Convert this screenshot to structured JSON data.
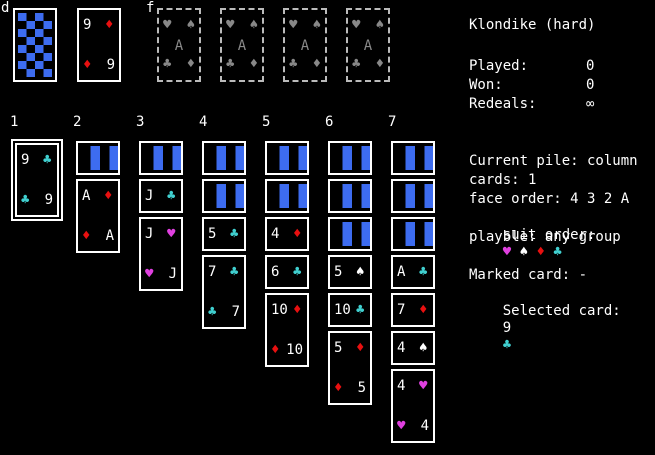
{
  "colors": {
    "red": "#e81010",
    "cyan": "#40d0d0",
    "magenta": "#e040e0",
    "white": "#ffffff",
    "back_blue": "#3d6cf0"
  },
  "labels": {
    "deck": "d",
    "foundation": "f",
    "columns": [
      "1",
      "2",
      "3",
      "4",
      "5",
      "6",
      "7"
    ]
  },
  "deck": {
    "face_down": true
  },
  "waste": {
    "rank": "9",
    "suit": "♦",
    "suit_color": "red"
  },
  "foundations": [
    {
      "top_left": "♥",
      "top_right": "♠",
      "mid": "A",
      "bottom_left": "♣",
      "bottom_right": "♦"
    },
    {
      "top_left": "♥",
      "top_right": "♠",
      "mid": "A",
      "bottom_left": "♣",
      "bottom_right": "♦"
    },
    {
      "top_left": "♥",
      "top_right": "♠",
      "mid": "A",
      "bottom_left": "♣",
      "bottom_right": "♦"
    },
    {
      "top_left": "♥",
      "top_right": "♠",
      "mid": "A",
      "bottom_left": "♣",
      "bottom_right": "♦"
    }
  ],
  "tableau": [
    {
      "hidden": 0,
      "cards": [
        {
          "rank": "9",
          "suit": "♣",
          "color": "cyan",
          "selected": true
        }
      ]
    },
    {
      "hidden": 1,
      "cards": [
        {
          "rank": "A",
          "suit": "♦",
          "color": "red"
        }
      ]
    },
    {
      "hidden": 1,
      "cards": [
        {
          "rank": "J",
          "suit": "♣",
          "color": "cyan"
        },
        {
          "rank": "J",
          "suit": "♥",
          "color": "magenta"
        }
      ]
    },
    {
      "hidden": 2,
      "cards": [
        {
          "rank": "5",
          "suit": "♣",
          "color": "cyan"
        },
        {
          "rank": "7",
          "suit": "♣",
          "color": "cyan"
        }
      ]
    },
    {
      "hidden": 2,
      "cards": [
        {
          "rank": "4",
          "suit": "♦",
          "color": "red"
        },
        {
          "rank": "6",
          "suit": "♣",
          "color": "cyan"
        },
        {
          "rank": "10",
          "suit": "♦",
          "color": "red"
        }
      ]
    },
    {
      "hidden": 3,
      "cards": [
        {
          "rank": "5",
          "suit": "♠",
          "color": "white"
        },
        {
          "rank": "10",
          "suit": "♣",
          "color": "cyan"
        },
        {
          "rank": "5",
          "suit": "♦",
          "color": "red"
        }
      ]
    },
    {
      "hidden": 3,
      "cards": [
        {
          "rank": "A",
          "suit": "♣",
          "color": "cyan"
        },
        {
          "rank": "7",
          "suit": "♦",
          "color": "red"
        },
        {
          "rank": "4",
          "suit": "♠",
          "color": "white"
        },
        {
          "rank": "4",
          "suit": "♥",
          "color": "magenta"
        }
      ]
    }
  ],
  "sidebar": {
    "title": "Klondike (hard)",
    "played_label": "Played:",
    "played_value": "0",
    "won_label": "Won:",
    "won_value": "0",
    "redeals_label": "Redeals:",
    "redeals_value": "∞",
    "current_pile": "Current pile: column",
    "cards_count": "cards: 1",
    "face_order": "face order: 4 3 2 A",
    "suit_order_label": "suit order:",
    "suit_order": [
      {
        "suit": "♥",
        "color": "magenta"
      },
      {
        "suit": "♠",
        "color": "white"
      },
      {
        "suit": "♦",
        "color": "red"
      },
      {
        "suit": "♣",
        "color": "cyan"
      }
    ],
    "playable": "playble: any group",
    "marked_card": "Marked card: -",
    "selected_label": "Selected card:",
    "selected_rank": "9",
    "selected_suit": "♣",
    "selected_color": "cyan"
  }
}
